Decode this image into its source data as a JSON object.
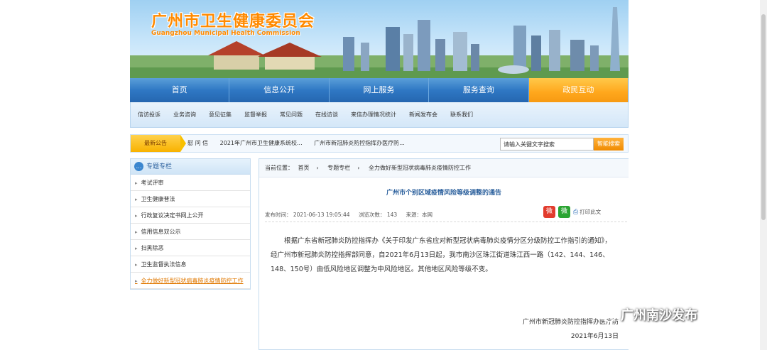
{
  "header": {
    "title": "广州市卫生健康委员会",
    "subtitle": "Guangzhou Municipal Health Commission"
  },
  "main_nav": [
    {
      "label": "首页"
    },
    {
      "label": "信息公开"
    },
    {
      "label": "网上服务"
    },
    {
      "label": "服务查询"
    },
    {
      "label": "政民互动"
    }
  ],
  "sub_nav": [
    {
      "label": "信访投诉"
    },
    {
      "label": "业务咨询"
    },
    {
      "label": "意见征集"
    },
    {
      "label": "监督举报"
    },
    {
      "label": "常见问题"
    },
    {
      "label": "在线访谈"
    },
    {
      "label": "来信办理情况统计"
    },
    {
      "label": "新闻发布会"
    },
    {
      "label": "联系我们"
    }
  ],
  "notice": {
    "label": "最新公告",
    "items": [
      "慰 问 信",
      "2021年广州市卫生健康系统校...",
      "广州市新冠肺炎防控指挥办医疗防..."
    ]
  },
  "search": {
    "placeholder": "请输入关键文字搜索",
    "button": "智能搜索"
  },
  "sidebar": {
    "title": "专题专栏",
    "items": [
      {
        "label": "考试评审"
      },
      {
        "label": "卫生健康普法"
      },
      {
        "label": "行政复议决定书网上公开"
      },
      {
        "label": "信用信息双公示"
      },
      {
        "label": "扫黑除恶"
      },
      {
        "label": "卫生监督执法信息"
      },
      {
        "label": "全力做好新型冠状病毒肺炎疫情防控工作"
      }
    ]
  },
  "breadcrumb": {
    "prefix": "当前位置：",
    "items": [
      "首页",
      "专题专栏",
      "全力做好新型冠状病毒肺炎疫情防控工作"
    ]
  },
  "article": {
    "title": "广州市个别区域疫情风险等级调整的通告",
    "meta_time": "发布时间： 2021-06-13 19:05:44",
    "meta_views": "浏览次数： 143",
    "meta_source": "来源：本网",
    "print_label": "打印此文",
    "body": "根据广东省新冠肺炎防控指挥办《关于印发广东省应对新型冠状病毒肺炎疫情分区分级防控工作指引的通知》，经广州市新冠肺炎防控指挥部同意，自2021年6月13日起，我市南沙区珠江街道珠江西一路（142、144、146、148、150号）由低风险地区调整为中风险地区。其他地区风险等级不变。",
    "signer": "广州市新冠肺炎防控指挥办医疗防",
    "date": "2021年6月13日"
  },
  "watermark": "广州南沙发布"
}
